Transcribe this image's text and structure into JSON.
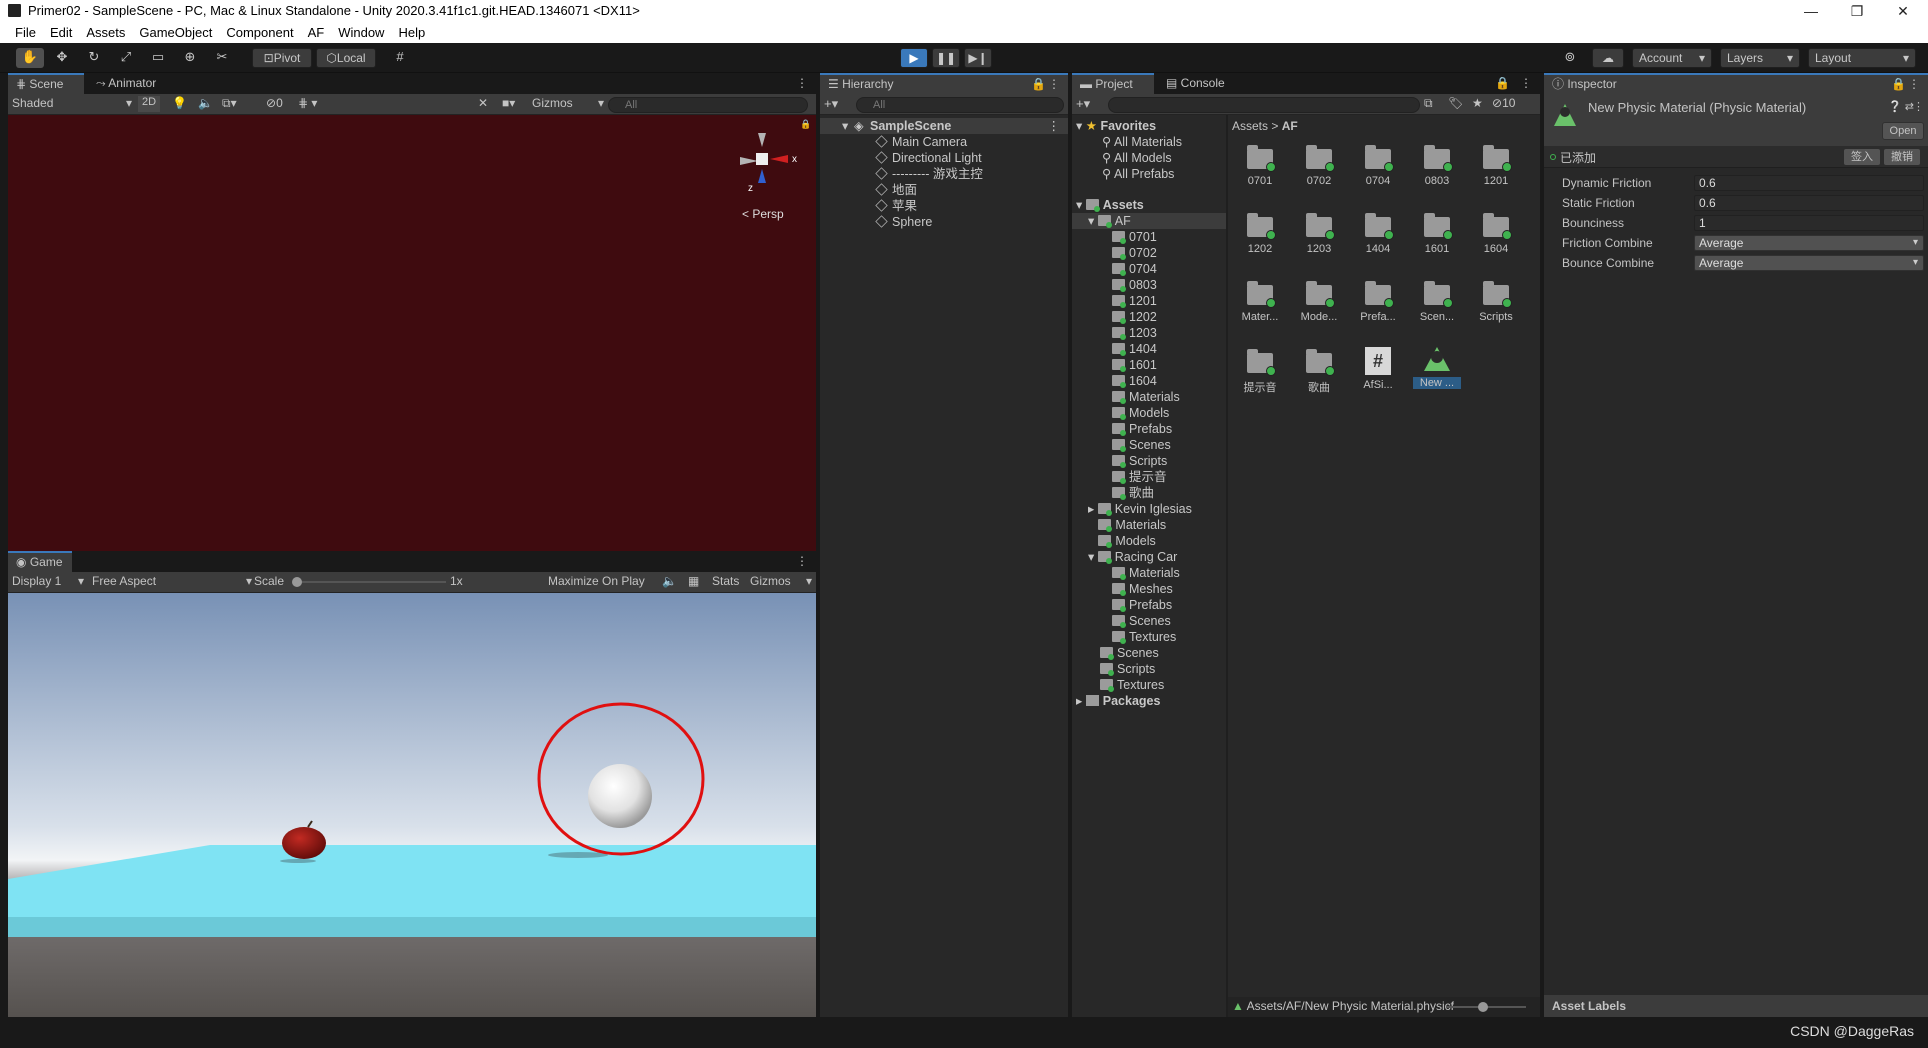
{
  "window": {
    "title": "Primer02 - SampleScene - PC, Mac & Linux Standalone - Unity 2020.3.41f1c1.git.HEAD.1346071 <DX11>",
    "minimize": "—",
    "restore": "❐",
    "close": "✕"
  },
  "menu": [
    "File",
    "Edit",
    "Assets",
    "GameObject",
    "Component",
    "AF",
    "Window",
    "Help"
  ],
  "toolbar": {
    "pivot": "Pivot",
    "local": "Local",
    "account": "Account",
    "layers": "Layers",
    "layout": "Layout"
  },
  "scene": {
    "tab_scene": "Scene",
    "tab_animator": "Animator",
    "shading": "Shaded",
    "mode_2d": "2D",
    "hidden_count": "0",
    "gizmos": "Gizmos",
    "search_placeholder": "All",
    "persp": "< Persp",
    "axis_x": "x",
    "axis_z": "z",
    "background": "#3f0b0f"
  },
  "game": {
    "tab": "Game",
    "display": "Display 1",
    "aspect": "Free Aspect",
    "scale_label": "Scale",
    "scale_value": "1x",
    "maximize": "Maximize On Play",
    "stats": "Stats",
    "gizmos": "Gizmos"
  },
  "hierarchy": {
    "tab": "Hierarchy",
    "search_placeholder": "All",
    "scene": "SampleScene",
    "items": [
      "Main Camera",
      "Directional Light",
      "--------- 游戏主控",
      "地面",
      "苹果",
      "Sphere"
    ]
  },
  "project": {
    "tab_project": "Project",
    "tab_console": "Console",
    "hidden_count": "10",
    "favorites": "Favorites",
    "fav_items": [
      "All Materials",
      "All Models",
      "All Prefabs"
    ],
    "assets": "Assets",
    "af": "AF",
    "af_children": [
      "0701",
      "0702",
      "0704",
      "0803",
      "1201",
      "1202",
      "1203",
      "1404",
      "1601",
      "1604",
      "Materials",
      "Models",
      "Prefabs",
      "Scenes",
      "Scripts",
      "提示音",
      "歌曲"
    ],
    "asset_children": [
      "Kevin Iglesias",
      "Materials",
      "Models",
      "Racing Car"
    ],
    "racing_children": [
      "Materials",
      "Meshes",
      "Prefabs",
      "Scenes",
      "Textures"
    ],
    "asset_tail": [
      "Scenes",
      "Scripts",
      "Textures"
    ],
    "packages": "Packages",
    "breadcrumb_root": "Assets",
    "breadcrumb_sep": ">",
    "breadcrumb_current": "AF",
    "grid": [
      "0701",
      "0702",
      "0704",
      "0803",
      "1201",
      "1202",
      "1203",
      "1404",
      "1601",
      "1604",
      "Mater...",
      "Mode...",
      "Prefa...",
      "Scen...",
      "Scripts",
      "提示音",
      "歌曲",
      "AfSi...",
      "New ..."
    ],
    "status_path": "Assets/AF/New Physic Material.physicf"
  },
  "inspector": {
    "tab": "Inspector",
    "title": "New Physic Material (Physic Material)",
    "open": "Open",
    "added": "已添加",
    "checkin": "签入",
    "revert": "撤销",
    "props": [
      {
        "label": "Dynamic Friction",
        "value": "0.6"
      },
      {
        "label": "Static Friction",
        "value": "0.6"
      },
      {
        "label": "Bounciness",
        "value": "1"
      },
      {
        "label": "Friction Combine",
        "value": "Average"
      },
      {
        "label": "Bounce Combine",
        "value": "Average"
      }
    ],
    "asset_labels": "Asset Labels"
  },
  "watermark": "CSDN @DaggeRas"
}
